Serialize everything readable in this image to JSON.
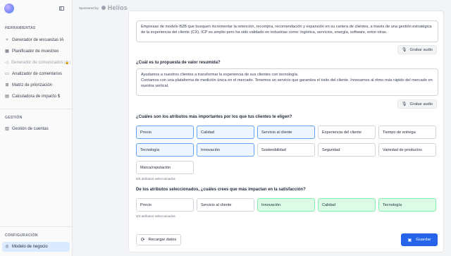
{
  "sidebar": {
    "tools_title": "HERRAMIENTAS",
    "items": [
      {
        "label": "Generador de encuestas IA",
        "icon": "sparkle-icon"
      },
      {
        "label": "Planificador de muestreo",
        "icon": "calendar-icon"
      },
      {
        "label": "Generador de comunicados",
        "icon": "megaphone-icon",
        "disabled": true,
        "badge": "(🔒)"
      },
      {
        "label": "Analizador de comentarios",
        "icon": "chat-icon"
      },
      {
        "label": "Matriz de priorización",
        "icon": "grid-icon"
      },
      {
        "label": "Calculadora de impacto $",
        "icon": "calculator-icon"
      }
    ],
    "management_title": "GESTIÓN",
    "management_items": [
      {
        "label": "Gestión de cuentas",
        "icon": "building-icon"
      }
    ],
    "config_title": "CONFIGURACIÓN",
    "config_items": [
      {
        "label": "Modelo de negocio",
        "icon": "target-icon",
        "active": true
      }
    ]
  },
  "header": {
    "sponsored_by": "Sponsored by",
    "sponsor_name": "Helios"
  },
  "form": {
    "segment_text": "Empresas de modelo B2B que busquen incrementar la retención, recompra, recomendación y expansión en su cartera de clientes, a través de una gestión estratégica de la experiencia del cliente (CX). ICP es amplio pero ha sido validado en industrias como: logística, servicios, energía, software, entre otras.",
    "record_audio_label": "Grabar audio",
    "value_prop_question": "¿Cuál es tu propuesta de valor resumida?",
    "value_prop_line1": "Ayudamos a nuestros clientes a transformar la experiencia de sus clientes con tecnología.",
    "value_prop_line2": "Contamos con una plataforma de medición única en el mercado. Tenemos un servicio que garantiza el éxito del cliente. Innovamos al ritmo más rápido del mercado en nuestra vertical.",
    "attributes_question": "¿Cuáles son los atributos más importantes por los que tus clientes te eligen?",
    "attributes": [
      {
        "label": "Precio",
        "selected": true
      },
      {
        "label": "Calidad",
        "selected": true
      },
      {
        "label": "Servicio al cliente",
        "selected": true
      },
      {
        "label": "Experiencia del cliente",
        "selected": false
      },
      {
        "label": "Tiempo de entrega",
        "selected": false
      },
      {
        "label": "Tecnología",
        "selected": true
      },
      {
        "label": "Innovación",
        "selected": true
      },
      {
        "label": "Sostenibilidad",
        "selected": false
      },
      {
        "label": "Seguridad",
        "selected": false
      },
      {
        "label": "Variedad de productos",
        "selected": false
      },
      {
        "label": "Marca/reputación",
        "selected": false
      }
    ],
    "attributes_count": "5/5 atributos seleccionados",
    "impact_question": "De los atributos seleccionados, ¿cuáles crees que más impactan en la satisfacción?",
    "impact_attributes": [
      {
        "label": "Precio",
        "selected": false
      },
      {
        "label": "Servicio al cliente",
        "selected": false
      },
      {
        "label": "Innovación",
        "selected": true
      },
      {
        "label": "Calidad",
        "selected": true
      },
      {
        "label": "Tecnología",
        "selected": true
      }
    ],
    "impact_count": "3/3 atributos seleccionados",
    "reload_label": "Recargar datos",
    "save_label": "Guardar"
  },
  "colors": {
    "accent": "#2563eb",
    "selected_bg": "#eff6ff",
    "selected_border": "#60a5fa",
    "impact_bg": "#dcfce7",
    "active_nav": "#dbeafe"
  }
}
